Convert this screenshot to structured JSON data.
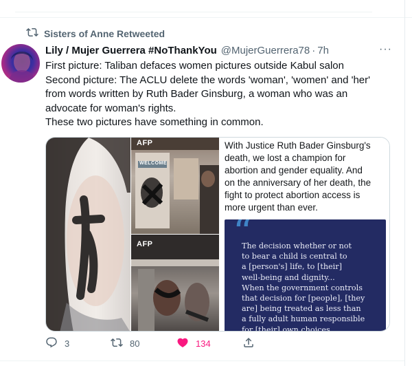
{
  "tweet": {
    "retweeted_by": "Sisters of Anne Retweeted",
    "author": {
      "name": "Lily / Mujer Guerrera #NoThankYou",
      "handle": "@MujerGuerrera78",
      "separator": "·",
      "time": "7h"
    },
    "more_label": "···",
    "text_lines": [
      "First picture: Taliban defaces women pictures outside Kabul salon",
      "Second picture: The ACLU delete the words 'woman', 'women' and 'her'",
      "from words written by Ruth Bader Ginsburg, a woman who was an",
      "advocate for woman's rights.",
      "These two pictures have something in common."
    ],
    "media": {
      "photo_credit": "AFP",
      "top_sign": "WELCOME",
      "screenshot_text_lines": [
        "With Justice Ruth Bader Ginsburg's",
        "death, we lost a champion for",
        "abortion and gender equality. And",
        "on the anniversary of her death, the",
        "fight to protect abortion access is",
        "more urgent than ever."
      ],
      "quote_mark": "“",
      "quote_lines": [
        "The decision whether or not",
        "to bear a child is central to",
        "a [person's] life, to [their]",
        "well-being and dignity...",
        "When the government controls",
        "that decision for [people], [they",
        "are] being treated as less than",
        "a fully adult human responsible",
        "for [their] own choices."
      ],
      "quote_card_color": "#232b63",
      "quote_mark_color": "#3f84c6"
    },
    "actions": {
      "replies": "3",
      "retweets": "80",
      "likes": "134",
      "liked": true,
      "like_color": "#f91880"
    }
  }
}
